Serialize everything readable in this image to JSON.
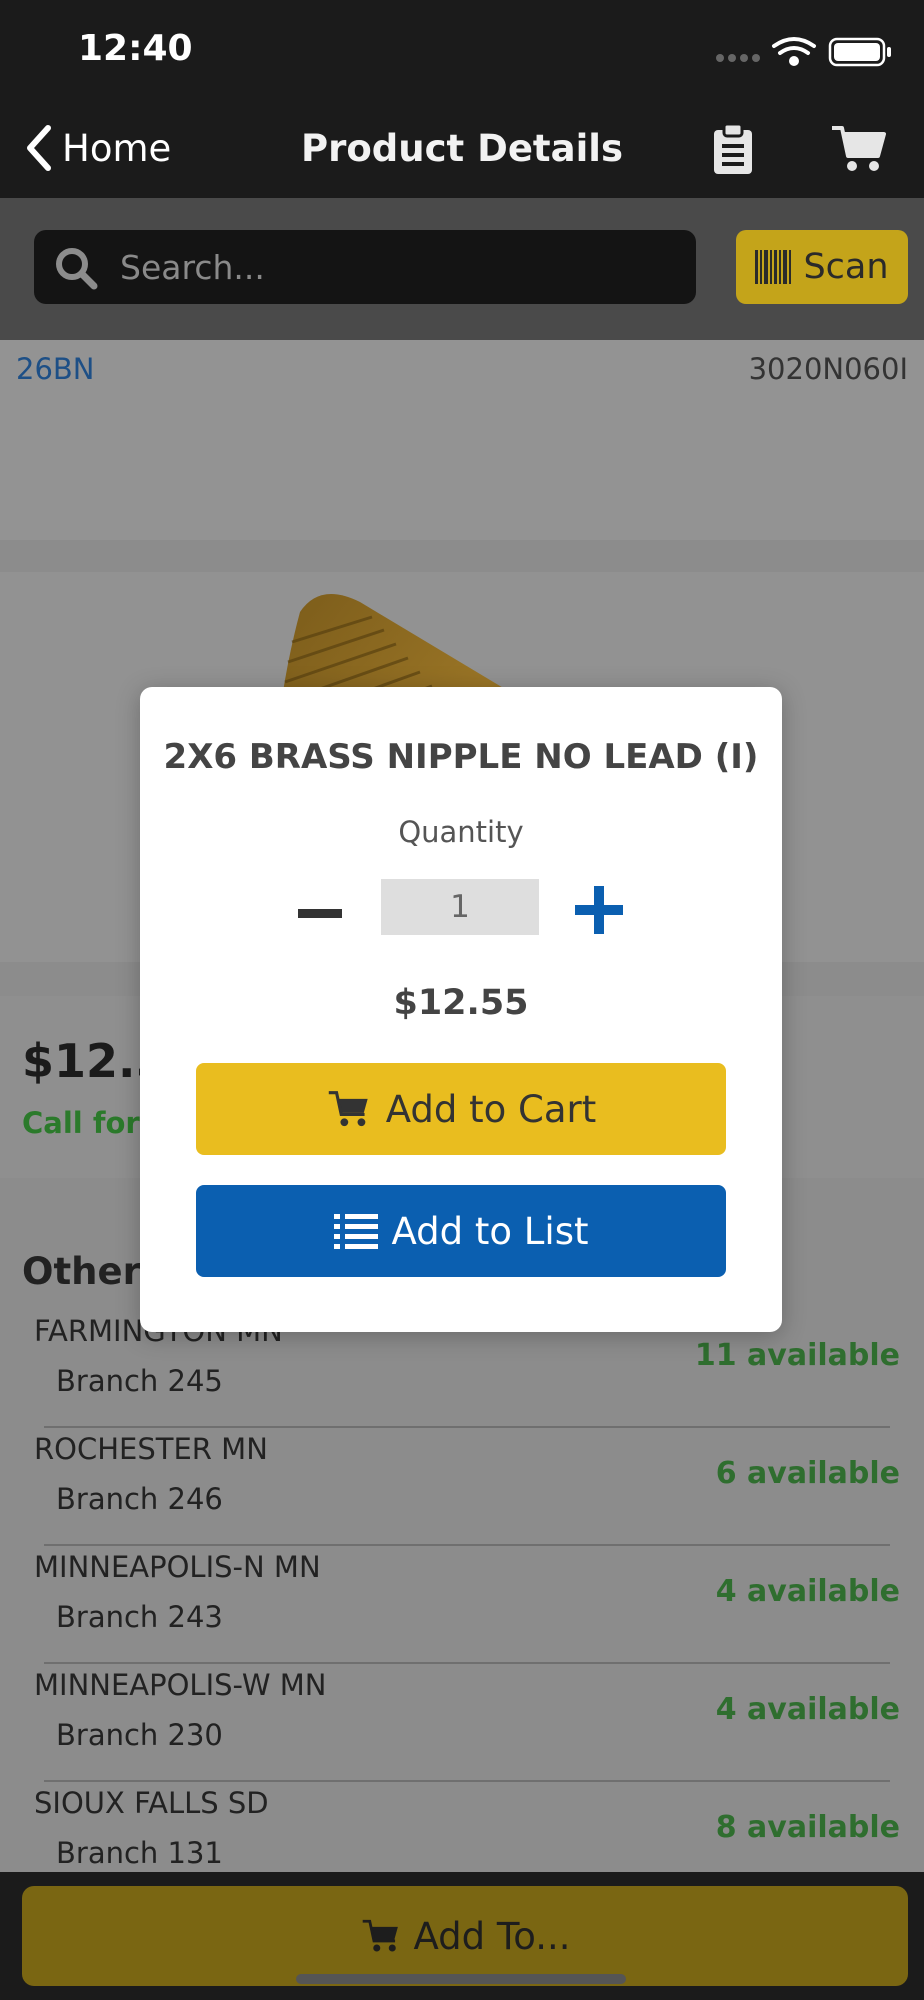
{
  "status_bar": {
    "time": "12:40"
  },
  "nav": {
    "back_label": "Home",
    "title": "Product Details"
  },
  "search": {
    "placeholder": "Search...",
    "scan_label": "Scan"
  },
  "product": {
    "sku_left": "26BN",
    "sku_right": "3020N060I",
    "price": "$12.55",
    "call_for_label": "Call for availability"
  },
  "other_locations": {
    "title": "Other Locations",
    "branches": [
      {
        "city": "FARMINGTON MN",
        "branch": "Branch 245",
        "availability": "11 available"
      },
      {
        "city": "ROCHESTER MN",
        "branch": "Branch 246",
        "availability": "6 available"
      },
      {
        "city": "MINNEAPOLIS-N MN",
        "branch": "Branch 243",
        "availability": "4 available"
      },
      {
        "city": "MINNEAPOLIS-W MN",
        "branch": "Branch 230",
        "availability": "4 available"
      },
      {
        "city": "SIOUX FALLS SD",
        "branch": "Branch 131",
        "availability": "8 available"
      }
    ]
  },
  "bottom_bar": {
    "add_to_label": "Add To..."
  },
  "modal": {
    "title": "2X6 BRASS NIPPLE NO LEAD (I)",
    "quantity_label": "Quantity",
    "quantity_value": "1",
    "price": "$12.55",
    "add_to_cart_label": "Add to Cart",
    "add_to_list_label": "Add to List"
  },
  "colors": {
    "accent_yellow": "#e9bd1f",
    "accent_blue": "#0b5fb0",
    "availability_green": "#2f6e2f",
    "header_dark": "#1b1b1b"
  },
  "icons": [
    "chevron-left-icon",
    "clipboard-icon",
    "cart-icon",
    "search-icon",
    "barcode-icon",
    "list-icon",
    "wifi-icon",
    "battery-icon",
    "signal-icon"
  ]
}
